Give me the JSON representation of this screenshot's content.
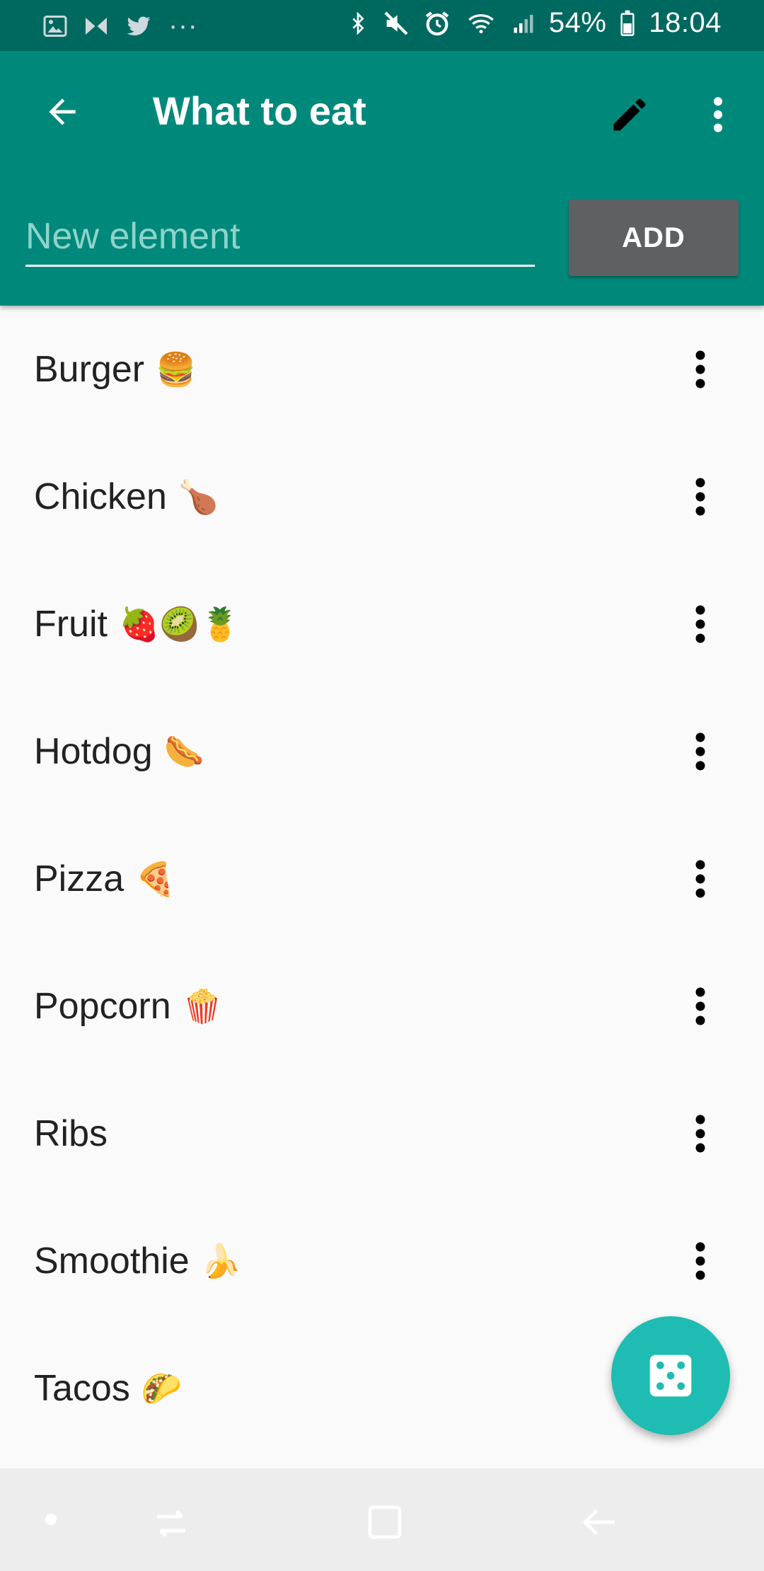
{
  "status_bar": {
    "battery_percent": "54%",
    "time": "18:04"
  },
  "app_bar": {
    "title": "What to eat"
  },
  "new_element": {
    "placeholder": "New element",
    "add_label": "ADD"
  },
  "items": [
    {
      "label": "Burger",
      "emoji": "🍔"
    },
    {
      "label": "Chicken",
      "emoji": "🍗"
    },
    {
      "label": "Fruit",
      "emoji": "🍓🥝🍍"
    },
    {
      "label": "Hotdog",
      "emoji": "🌭"
    },
    {
      "label": "Pizza",
      "emoji": "🍕"
    },
    {
      "label": "Popcorn",
      "emoji": "🍿"
    },
    {
      "label": "Ribs",
      "emoji": ""
    },
    {
      "label": "Smoothie",
      "emoji": "🍌"
    },
    {
      "label": "Tacos",
      "emoji": "🌮"
    }
  ],
  "colors": {
    "status_bar": "#00695f",
    "app_bar": "#00897b",
    "fab": "#1ebcb2",
    "add_button": "#5f6062"
  }
}
